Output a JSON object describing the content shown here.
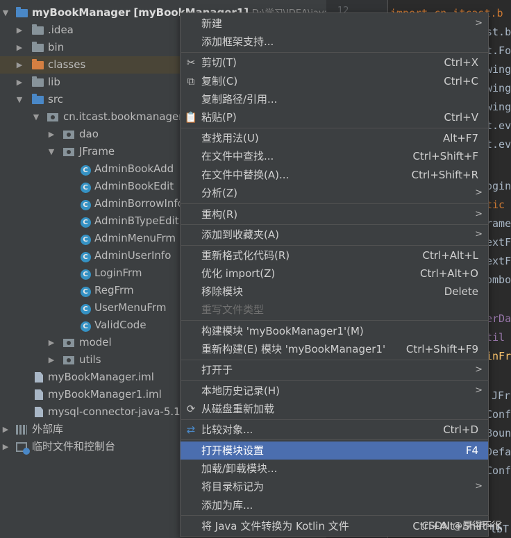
{
  "tree": {
    "project": {
      "name": "myBookManager",
      "bracket": "[myBookManager1]",
      "path": "D:\\学习\\IDEA\\java"
    },
    "items": [
      {
        "label": ".idea"
      },
      {
        "label": "bin"
      },
      {
        "label": "classes"
      },
      {
        "label": "lib"
      },
      {
        "label": "src"
      },
      {
        "label": "cn.itcast.bookmanager"
      },
      {
        "label": "dao"
      },
      {
        "label": "JFrame"
      },
      {
        "label": "AdminBookAdd"
      },
      {
        "label": "AdminBookEdit"
      },
      {
        "label": "AdminBorrowInfo"
      },
      {
        "label": "AdminBTypeEdit"
      },
      {
        "label": "AdminMenuFrm"
      },
      {
        "label": "AdminUserInfo"
      },
      {
        "label": "LoginFrm"
      },
      {
        "label": "RegFrm"
      },
      {
        "label": "UserMenuFrm"
      },
      {
        "label": "ValidCode"
      },
      {
        "label": "model"
      },
      {
        "label": "utils"
      },
      {
        "label": "myBookManager.iml"
      },
      {
        "label": "myBookManager1.iml"
      },
      {
        "label": "mysql-connector-java-5.1."
      },
      {
        "label": "外部库"
      },
      {
        "label": "临时文件和控制台"
      }
    ]
  },
  "editor": {
    "line_number": "12",
    "lines": [
      "import cn.itcast.b",
      "st.b",
      "t.Fo",
      "wing",
      "wing",
      "wing",
      "t.ev",
      "t.ev",
      "",
      "ogin",
      "tic",
      "rame",
      "extF",
      "extF",
      "ombo",
      "",
      "erDa",
      "til",
      "inFr",
      "",
      "JFr",
      "Conf",
      "Boun",
      "Defa",
      "Conf",
      "",
      "lbT"
    ]
  },
  "menu": {
    "items": [
      {
        "label": "新建",
        "shortcut": "",
        "submenu": ">"
      },
      {
        "label": "添加框架支持...",
        "shortcut": ""
      },
      {
        "label": "剪切(T)",
        "shortcut": "Ctrl+X"
      },
      {
        "label": "复制(C)",
        "shortcut": "Ctrl+C"
      },
      {
        "label": "复制路径/引用...",
        "shortcut": ""
      },
      {
        "label": "粘贴(P)",
        "shortcut": "Ctrl+V"
      },
      {
        "label": "查找用法(U)",
        "shortcut": "Alt+F7"
      },
      {
        "label": "在文件中查找...",
        "shortcut": "Ctrl+Shift+F"
      },
      {
        "label": "在文件中替换(A)...",
        "shortcut": "Ctrl+Shift+R"
      },
      {
        "label": "分析(Z)",
        "shortcut": "",
        "submenu": ">"
      },
      {
        "label": "重构(R)",
        "shortcut": "",
        "submenu": ">"
      },
      {
        "label": "添加到收藏夹(A)",
        "shortcut": "",
        "submenu": ">"
      },
      {
        "label": "重新格式化代码(R)",
        "shortcut": "Ctrl+Alt+L"
      },
      {
        "label": "优化 import(Z)",
        "shortcut": "Ctrl+Alt+O"
      },
      {
        "label": "移除模块",
        "shortcut": "Delete"
      },
      {
        "label": "重写文件类型",
        "shortcut": ""
      },
      {
        "label": "构建模块 'myBookManager1'(M)",
        "shortcut": ""
      },
      {
        "label": "重新构建(E) 模块 'myBookManager1'",
        "shortcut": "Ctrl+Shift+F9"
      },
      {
        "label": "打开于",
        "shortcut": "",
        "submenu": ">"
      },
      {
        "label": "本地历史记录(H)",
        "shortcut": "",
        "submenu": ">"
      },
      {
        "label": "从磁盘重新加载",
        "shortcut": ""
      },
      {
        "label": "比较对象...",
        "shortcut": "Ctrl+D"
      },
      {
        "label": "打开模块设置",
        "shortcut": "F4"
      },
      {
        "label": "加载/卸载模块...",
        "shortcut": ""
      },
      {
        "label": "将目录标记为",
        "shortcut": "",
        "submenu": ">"
      },
      {
        "label": "添加为库...",
        "shortcut": ""
      },
      {
        "label": "将 Java 文件转换为 Kotlin 文件",
        "shortcut": "Ctrl+Alt+Shift+K"
      }
    ]
  },
  "watermark": "CSDN @厚得不行"
}
